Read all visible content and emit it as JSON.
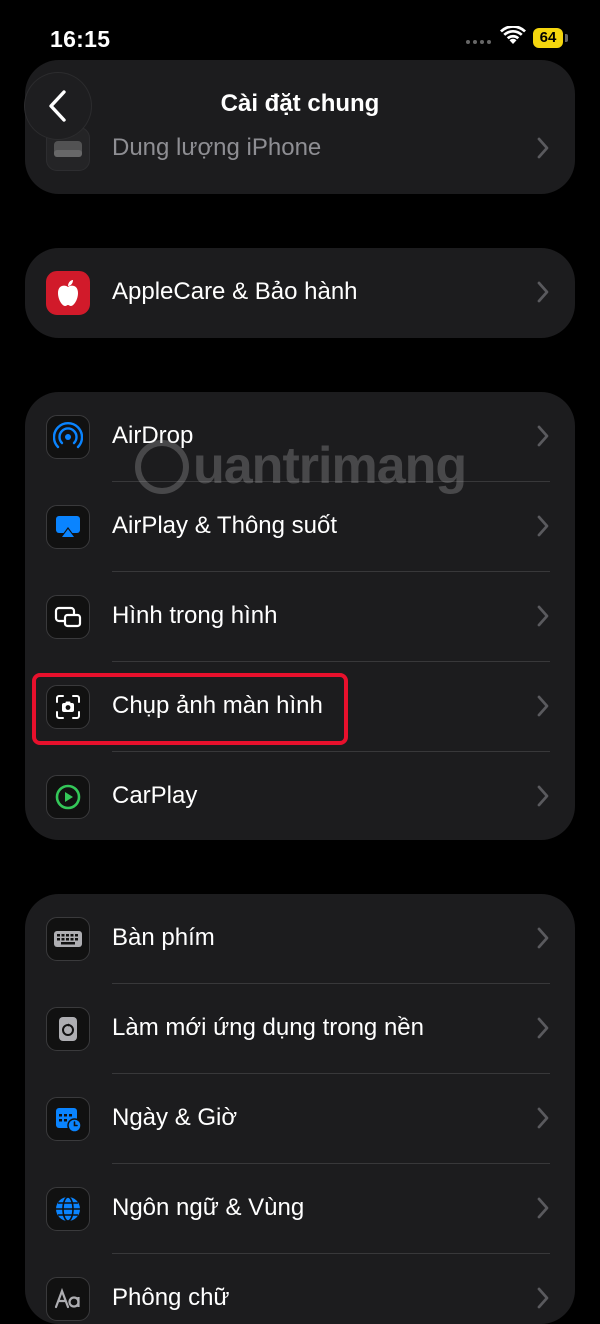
{
  "status_bar": {
    "time": "16:15",
    "battery": "64"
  },
  "nav": {
    "title": "Cài đặt chung"
  },
  "top_card": {
    "partial_label": "Dung lượng iPhone"
  },
  "group1": [
    {
      "label": "AppleCare & Bảo hành",
      "icon": "apple-logo-icon"
    }
  ],
  "group2": [
    {
      "label": "AirDrop",
      "icon": "airdrop-icon"
    },
    {
      "label": "AirPlay & Thông suốt",
      "icon": "airplay-icon"
    },
    {
      "label": "Hình trong hình",
      "icon": "picture-in-picture-icon"
    },
    {
      "label": "Chụp ảnh màn hình",
      "icon": "screenshot-icon"
    },
    {
      "label": "CarPlay",
      "icon": "carplay-icon"
    }
  ],
  "group3": [
    {
      "label": "Bàn phím",
      "icon": "keyboard-icon"
    },
    {
      "label": "Làm mới ứng dụng trong nền",
      "icon": "background-refresh-icon"
    },
    {
      "label": "Ngày & Giờ",
      "icon": "calendar-clock-icon"
    },
    {
      "label": "Ngôn ngữ & Vùng",
      "icon": "globe-icon"
    },
    {
      "label": "Phông chữ",
      "icon": "font-icon"
    }
  ],
  "watermark": {
    "text": "uantrimang"
  },
  "colors": {
    "background": "#000000",
    "card": "#1c1c1e",
    "highlight": "#e8102c",
    "accent_blue": "#0a84ff",
    "carplay_green": "#34c759",
    "battery": "#f5d60e"
  }
}
